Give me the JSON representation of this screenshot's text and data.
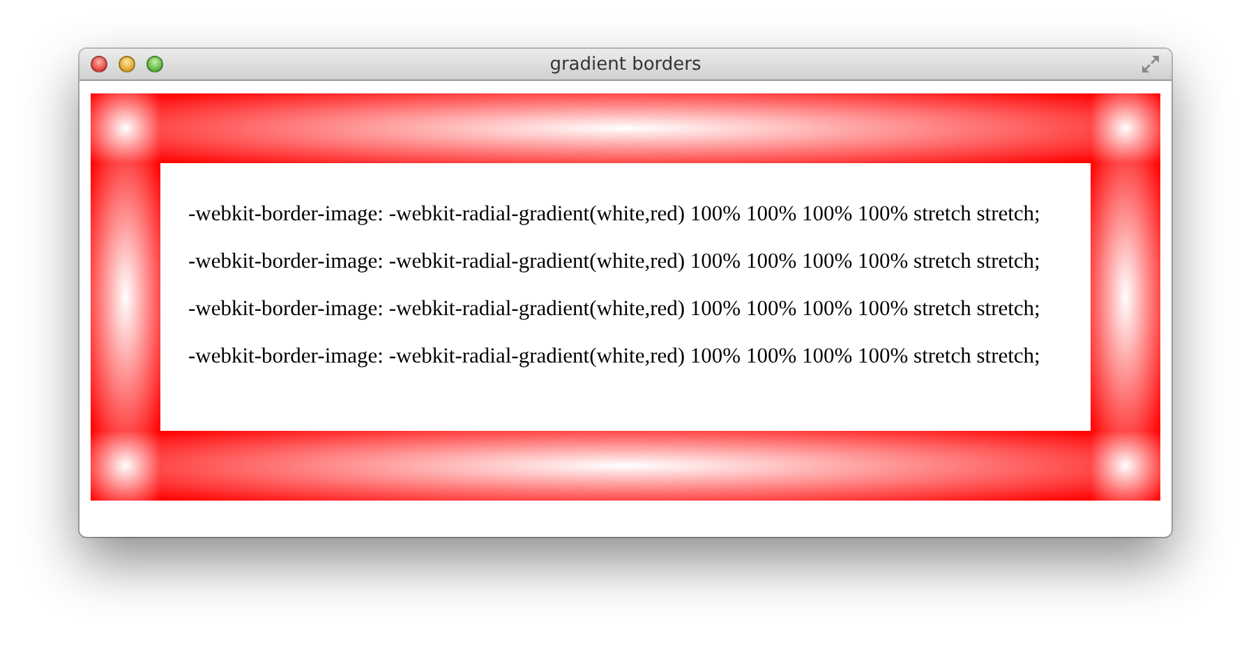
{
  "window": {
    "title": "gradient borders"
  },
  "content": {
    "lines": [
      "-webkit-border-image: -webkit-radial-gradient(white,red) 100% 100% 100% 100% stretch stretch;",
      "-webkit-border-image: -webkit-radial-gradient(white,red) 100% 100% 100% 100% stretch stretch;",
      "-webkit-border-image: -webkit-radial-gradient(white,red) 100% 100% 100% 100% stretch stretch;",
      "-webkit-border-image: -webkit-radial-gradient(white,red) 100% 100% 100% 100% stretch stretch;"
    ]
  }
}
